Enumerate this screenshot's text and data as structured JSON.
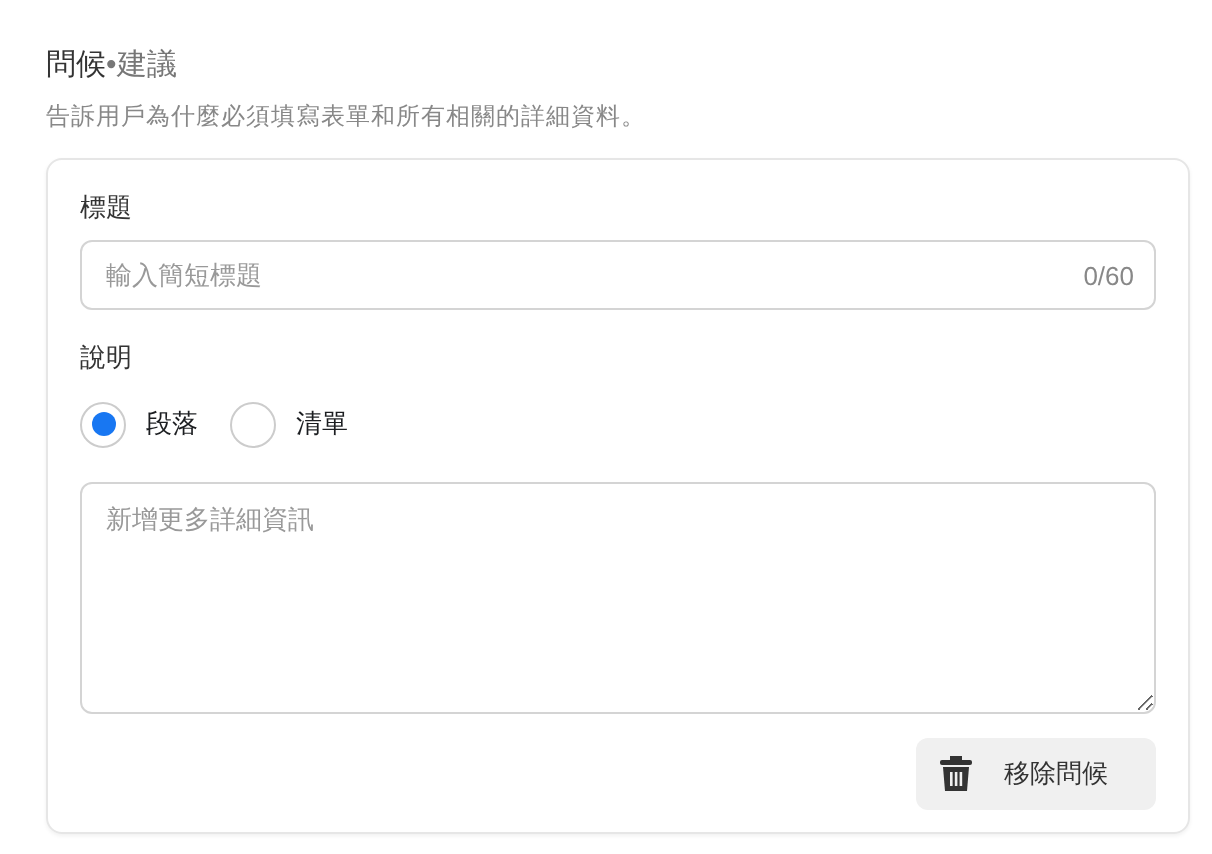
{
  "heading": {
    "main": "問候",
    "suffix": "•建議"
  },
  "description": "告訴用戶為什麼必須填寫表單和所有相關的詳細資料。",
  "title_field": {
    "label": "標題",
    "placeholder": "輸入簡短標題",
    "counter": "0/60"
  },
  "description_field": {
    "label": "說明",
    "options": [
      {
        "label": "段落",
        "selected": true
      },
      {
        "label": "清單",
        "selected": false
      }
    ],
    "placeholder": "新增更多詳細資訊"
  },
  "remove_button": {
    "label": "移除問候"
  }
}
